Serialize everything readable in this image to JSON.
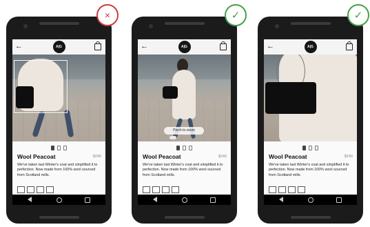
{
  "phones": [
    {
      "appbar": {
        "logo": "A|G"
      },
      "product": {
        "name": "Wool Peacoat",
        "price": "$240",
        "description": "We've taken last Winter's coat and simplified it to perfection. Now made from 100% wool sourced from Scotland mills."
      },
      "badge": {
        "symbol": "×",
        "meaning": "incorrect"
      }
    },
    {
      "appbar": {
        "logo": "A|G"
      },
      "product": {
        "name": "Wool Peacoat",
        "price": "$240",
        "description": "We've taken last Winter's coat and simplified it to perfection. Now made from 100% wool sourced from Scotland mills."
      },
      "photo": {
        "hint": "Pinch to zoom"
      },
      "badge": {
        "symbol": "✓",
        "meaning": "correct"
      }
    },
    {
      "appbar": {
        "logo": "A|G"
      },
      "product": {
        "name": "Wool Peacoat",
        "price": "$240",
        "description": "We've taken last Winter's coat and simplified it to perfection. Now made from 100% wool sourced from Scotland mills."
      },
      "badge": {
        "symbol": "✓",
        "meaning": "correct"
      }
    }
  ],
  "colors": {
    "bad": "#c93b3b",
    "good": "#43a047",
    "device": "#1b1b1b"
  },
  "icons": [
    "back-arrow-icon",
    "shopping-bag-icon",
    "nav-back-icon",
    "nav-home-icon",
    "nav-recent-icon",
    "cross-icon",
    "check-icon"
  ]
}
